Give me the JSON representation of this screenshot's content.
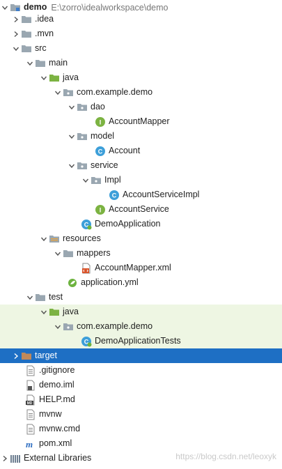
{
  "project": {
    "name": "demo",
    "path": "E:\\zorro\\idealworkspace\\demo"
  },
  "tree": {
    "idea": ".idea",
    "mvn": ".mvn",
    "src": "src",
    "main": "main",
    "main_java": "java",
    "main_pkg": "com.example.demo",
    "dao": "dao",
    "account_mapper": "AccountMapper",
    "model": "model",
    "account": "Account",
    "service": "service",
    "impl": "Impl",
    "account_service_impl": "AccountServiceImpl",
    "account_service": "AccountService",
    "demo_application": "DemoApplication",
    "resources": "resources",
    "mappers": "mappers",
    "account_mapper_xml": "AccountMapper.xml",
    "application_yml": "application.yml",
    "test": "test",
    "test_java": "java",
    "test_pkg": "com.example.demo",
    "demo_application_tests": "DemoApplicationTests",
    "target": "target",
    "gitignore": ".gitignore",
    "demo_iml": "demo.iml",
    "help_md": "HELP.md",
    "mvnw": "mvnw",
    "mvnw_cmd": "mvnw.cmd",
    "pom_xml": "pom.xml",
    "external_libraries": "External Libraries"
  },
  "icons": {
    "md_badge": "MD",
    "interface_badge": "I",
    "class_badge": "C"
  },
  "watermark": "https://blog.csdn.net/leoxyk",
  "colors": {
    "selection": "#1e6fc4",
    "test_bg": "#eef6e3",
    "folder": "#9aa7b1",
    "source_folder": "#7cb342",
    "interface": "#7cb342",
    "class": "#3d9fd9"
  }
}
